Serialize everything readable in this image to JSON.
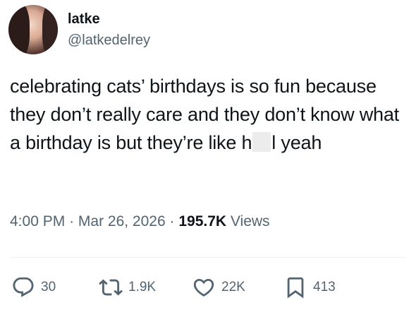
{
  "author": {
    "display_name": "latke",
    "handle": "@latkedelrey"
  },
  "tweet": {
    "text_before_censor": "celebrating cats’ birthdays is so fun because they don’t really care and they don’t know what a birthday is but they’re like h",
    "text_after_censor": "l yeah"
  },
  "meta": {
    "time": "4:00 PM",
    "separator": "·",
    "date": "Mar 26, 2026",
    "views_count": "195.7K",
    "views_label": "Views"
  },
  "actions": {
    "replies": "30",
    "reposts": "1.9K",
    "likes": "22K",
    "bookmarks": "413"
  },
  "icons": [
    "reply-icon",
    "repost-icon",
    "like-icon",
    "bookmark-icon"
  ]
}
